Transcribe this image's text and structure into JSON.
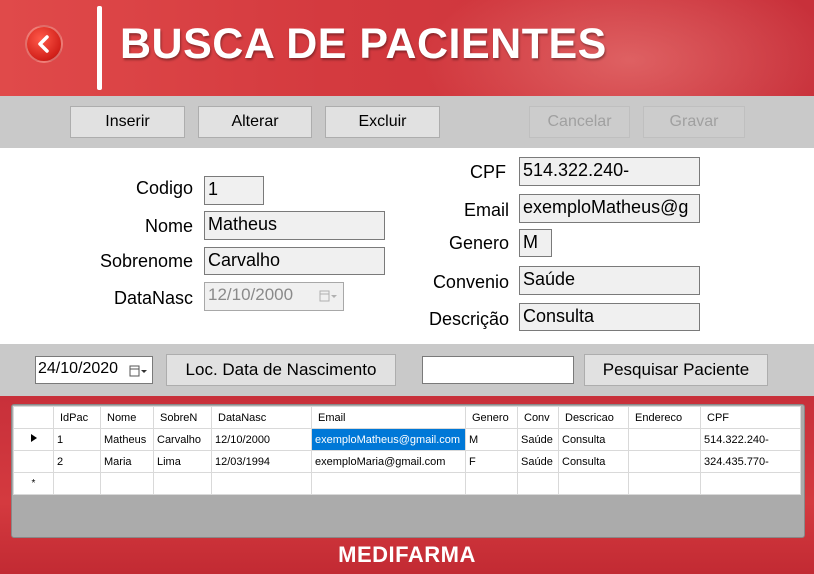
{
  "header": {
    "title": "BUSCA DE PACIENTES"
  },
  "toolbar": {
    "inserir": "Inserir",
    "alterar": "Alterar",
    "excluir": "Excluir",
    "cancelar": "Cancelar",
    "gravar": "Gravar"
  },
  "form": {
    "codigo_label": "Codigo",
    "codigo_value": "1",
    "nome_label": "Nome",
    "nome_value": "Matheus",
    "sobrenome_label": "Sobrenome",
    "sobrenome_value": "Carvalho",
    "datanasc_label": "DataNasc",
    "datanasc_value": "12/10/2000",
    "cpf_label": "CPF",
    "cpf_value": "514.322.240-",
    "email_label": "Email",
    "email_value": "exemploMatheus@g",
    "genero_label": "Genero",
    "genero_value": "M",
    "convenio_label": "Convenio",
    "convenio_value": "Saúde",
    "descricao_label": "Descrição",
    "descricao_value": "Consulta"
  },
  "search": {
    "date_value": "24/10/2020",
    "loc_button": "Loc. Data de Nascimento",
    "search_input_value": "",
    "search_button": "Pesquisar Paciente"
  },
  "grid": {
    "columns": [
      "IdPac",
      "Nome",
      "SobreN",
      "DataNasc",
      "Email",
      "Genero",
      "Conv",
      "Descricao",
      "Endereco",
      "CPF"
    ],
    "rows": [
      [
        "1",
        "Matheus",
        "Carvalho",
        "12/10/2000",
        "exemploMatheus@gmail.com",
        "M",
        "Saúde",
        "Consulta",
        "",
        "514.322.240-"
      ],
      [
        "2",
        "Maria",
        "Lima",
        "12/03/1994",
        "exemploMaria@gmail.com",
        "F",
        "Saúde",
        "Consulta",
        "",
        "324.435.770-"
      ]
    ],
    "new_row_marker": "*"
  },
  "footer": {
    "brand": "MEDIFARMA"
  },
  "colors": {
    "header_red": "#d43a3f",
    "toolbar_gray": "#c9c9c9",
    "selection_blue": "#0078d7"
  }
}
